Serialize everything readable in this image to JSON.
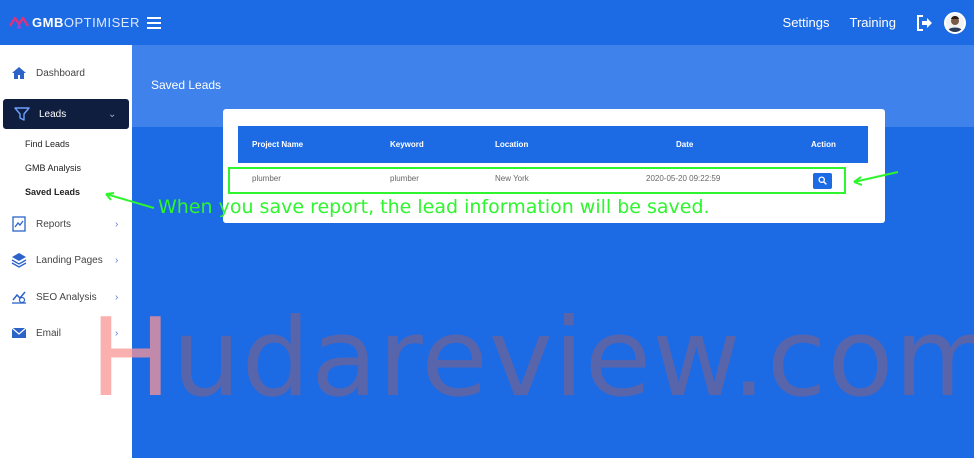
{
  "app": {
    "logo_bold": "GMB",
    "logo_light": "OPTIMISER"
  },
  "topnav": {
    "settings": "Settings",
    "training": "Training"
  },
  "sidebar": {
    "dashboard": "Dashboard",
    "leads": "Leads",
    "leads_sub": [
      "Find Leads",
      "GMB Analysis",
      "Saved Leads"
    ],
    "reports": "Reports",
    "landing_pages": "Landing Pages",
    "seo_analysis": "SEO Analysis",
    "email": "Email"
  },
  "page": {
    "title": "Saved Leads"
  },
  "table": {
    "headers": [
      "Project Name",
      "Keyword",
      "Location",
      "Date",
      "Action"
    ],
    "rows": [
      {
        "project_name": "plumber",
        "keyword": "plumber",
        "location": "New York",
        "date": "2020-05-20 09:22:59"
      }
    ]
  },
  "annotation": {
    "text": "When you save report, the lead information will be saved.",
    "color": "#2ef52e"
  },
  "watermark": {
    "first_letter": "H",
    "rest": "udareview.com"
  },
  "colors": {
    "primary": "#1d6ae5",
    "sidebar_active": "#0f1e3e",
    "highlight": "#2ef52e"
  }
}
